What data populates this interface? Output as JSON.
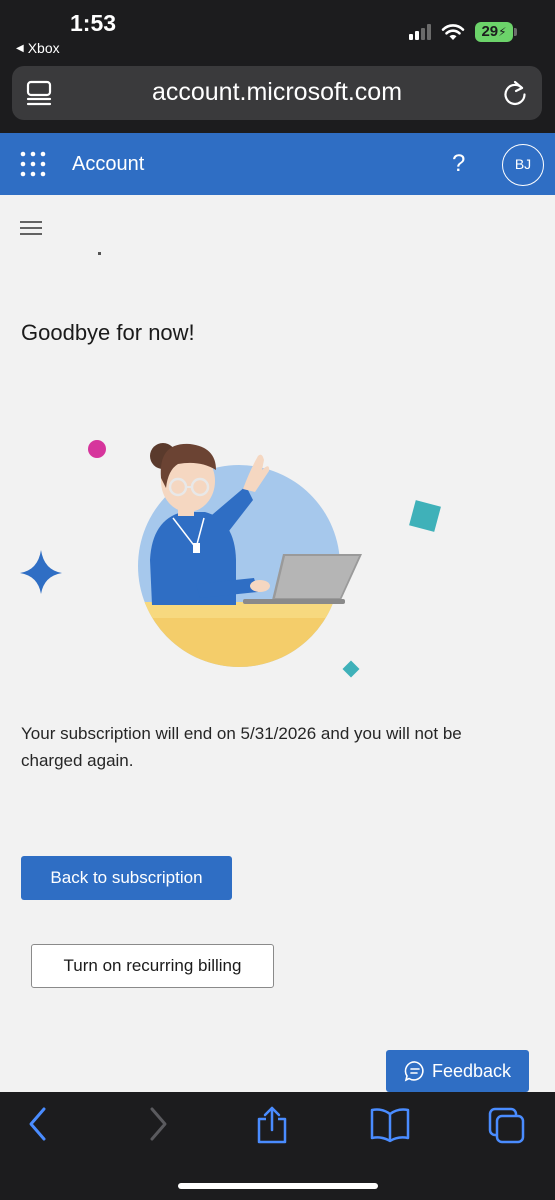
{
  "status": {
    "time": "1:53",
    "back_app": "Xbox",
    "battery": "29"
  },
  "browser": {
    "url": "account.microsoft.com"
  },
  "header": {
    "title": "Account",
    "help": "?",
    "avatar_initials": "BJ"
  },
  "page": {
    "title": "Goodbye for now!",
    "message": "Your subscription will end on 5/31/2026 and you will not be charged again.",
    "back_button": "Back to subscription",
    "recurring_button": "Turn on recurring billing",
    "feedback": "Feedback"
  },
  "icons": {
    "reader": "reader-mode-icon",
    "reload": "reload-icon",
    "waffle": "app-launcher-icon",
    "menu": "hamburger-icon",
    "feedback": "chat-bubble-icon",
    "back": "chevron-left-icon",
    "forward": "chevron-right-icon",
    "share": "share-icon",
    "bookmarks": "book-icon",
    "tabs": "tabs-icon"
  },
  "colors": {
    "accent": "#2f6ec4",
    "chrome": "#1c1c1e",
    "background": "#f2f2f2"
  }
}
